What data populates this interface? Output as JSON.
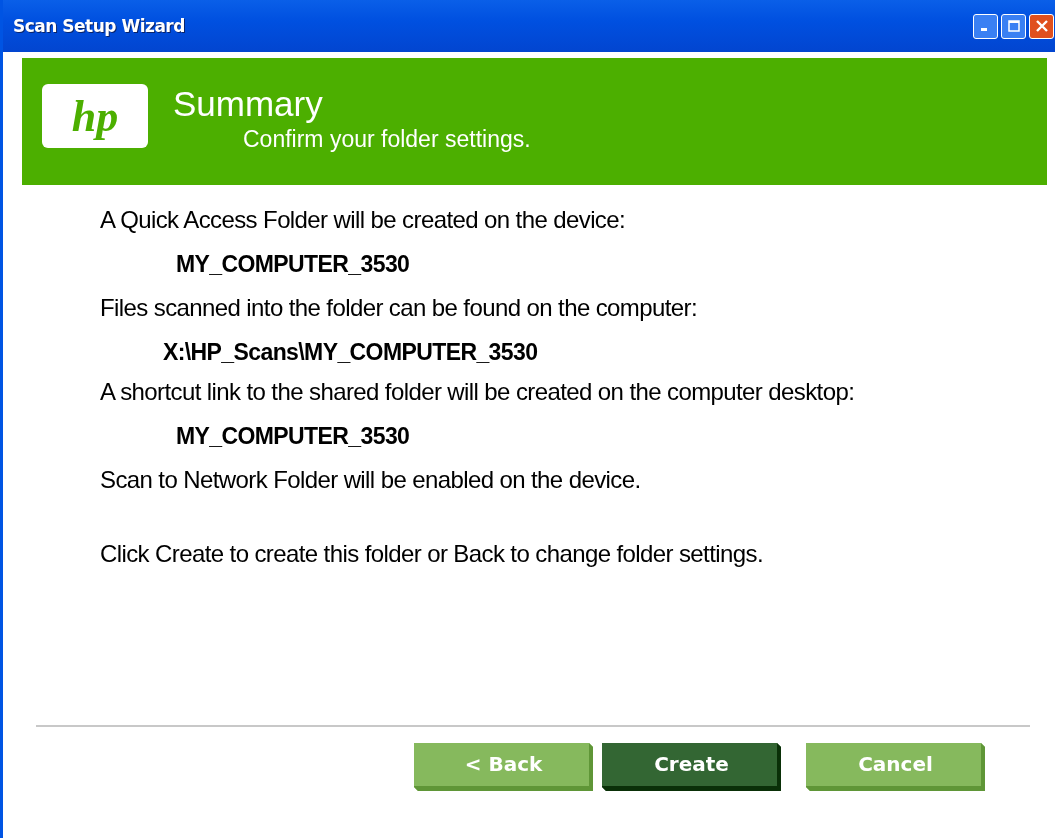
{
  "window": {
    "title": "Scan Setup Wizard"
  },
  "header": {
    "logo_text": "hp",
    "title": "Summary",
    "subtitle": "Confirm your folder settings."
  },
  "lines": [
    {
      "kind": "text",
      "text": "A Quick Access Folder will be created on the device:"
    },
    {
      "kind": "value",
      "text": "MY_COMPUTER_3530"
    },
    {
      "kind": "text",
      "text": "Files scanned into the folder can be found on the computer:"
    },
    {
      "kind": "path",
      "text": "X:\\HP_Scans\\MY_COMPUTER_3530"
    },
    {
      "kind": "text",
      "text": "A shortcut link to the shared folder will be created on the computer desktop:"
    },
    {
      "kind": "value",
      "text": "MY_COMPUTER_3530"
    },
    {
      "kind": "text",
      "text": "Scan to Network Folder will be enabled on the device."
    },
    {
      "kind": "note",
      "text": "Click Create to create this folder or Back to change folder settings."
    }
  ],
  "buttons": [
    {
      "label": "< Back",
      "default": false
    },
    {
      "label": "Create",
      "default": true
    },
    {
      "label": "Cancel",
      "default": false
    }
  ]
}
